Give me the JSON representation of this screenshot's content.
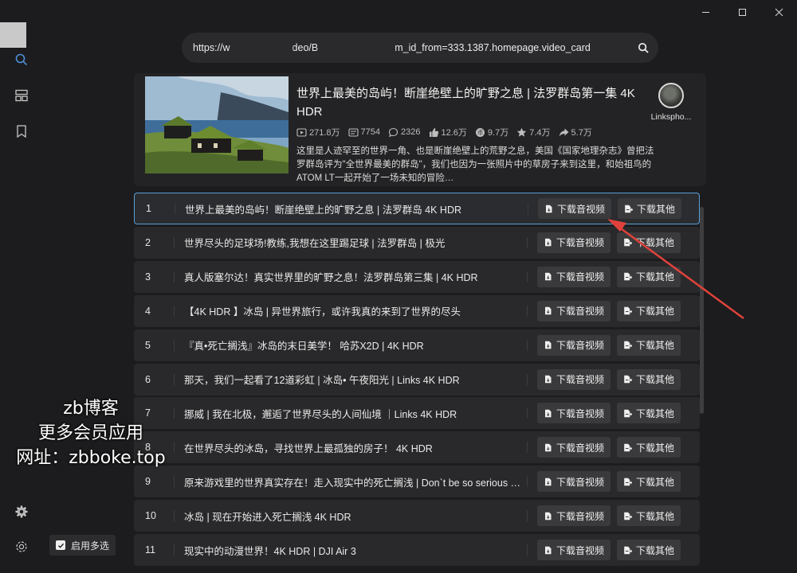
{
  "window": {
    "controls": [
      "minimize-icon",
      "maximize-icon",
      "close-icon"
    ]
  },
  "rail": {
    "icons": [
      "search-icon",
      "layout-icon",
      "bookmark-icon",
      "gear-icon",
      "settings-icon"
    ]
  },
  "url_bar": {
    "value_part1": "https://w",
    "value_part2": "deo/B",
    "value_part3": "m_id_from=333.1387.homepage.video_card"
  },
  "video": {
    "title": "世界上最美的岛屿！断崖绝壁上的旷野之息 | 法罗群岛第一集 4K HDR",
    "stats": {
      "views": "271.8万",
      "danmaku": "7754",
      "comments": "2326",
      "likes": "12.6万",
      "coins": "9.7万",
      "favorites": "7.4万",
      "shares": "5.7万"
    },
    "description": "这里是人迹罕至的世界一角、也是断崖绝壁上的荒野之息，美国《国家地理杂志》曾把法罗群岛评为\"全世界最美的群岛\"，我们也因为一张照片中的草房子来到这里，和始祖鸟的ATOM LT一起开始了一场未知的冒险…",
    "uploader": "Linkspho..."
  },
  "buttons": {
    "download_av": "下载音视频",
    "download_other": "下载其他"
  },
  "list": [
    {
      "num": "1",
      "title": "世界上最美的岛屿！断崖绝壁上的旷野之息 | 法罗群岛 4K HDR",
      "selected": true
    },
    {
      "num": "2",
      "title": "世界尽头的足球场!教练,我想在这里踢足球 | 法罗群岛 | 极光"
    },
    {
      "num": "3",
      "title": "真人版塞尔达！真实世界里的旷野之息！法罗群岛第三集 | 4K HDR"
    },
    {
      "num": "4",
      "title": "【4K HDR 】冰岛 | 异世界旅行，或许我真的来到了世界的尽头"
    },
    {
      "num": "5",
      "title": "『真•死亡搁浅』冰岛的末日美学！ 哈苏X2D | 4K HDR"
    },
    {
      "num": "6",
      "title": "那天，我们一起看了12道彩虹 | 冰岛• 午夜阳光 | Links 4K HDR"
    },
    {
      "num": "7",
      "title": "挪威 | 我在北极，邂逅了世界尽头的人间仙境 ｜Links 4K HDR"
    },
    {
      "num": "8",
      "title": "在世界尽头的冰岛，寻找世界上最孤独的房子！ 4K HDR"
    },
    {
      "num": "9",
      "title": "原来游戏里的世界真实存在！走入现实中的死亡搁浅 | Don`t be so serious …"
    },
    {
      "num": "10",
      "title": "冰岛 | 现在开始进入死亡搁浅 4K HDR"
    },
    {
      "num": "11",
      "title": "现实中的动漫世界！4K HDR | DJI Air 3"
    }
  ],
  "multi_select": {
    "label": "启用多选",
    "checked": true
  },
  "watermark": {
    "line1": "zb博客",
    "line2": "更多会员应用",
    "line3": "网址：zbboke.top"
  },
  "colors": {
    "background": "#1c1c1e",
    "row": "#29292b",
    "selected_border": "#5a9fd6",
    "button": "#3a3a3c",
    "arrow": "#e0423b"
  }
}
